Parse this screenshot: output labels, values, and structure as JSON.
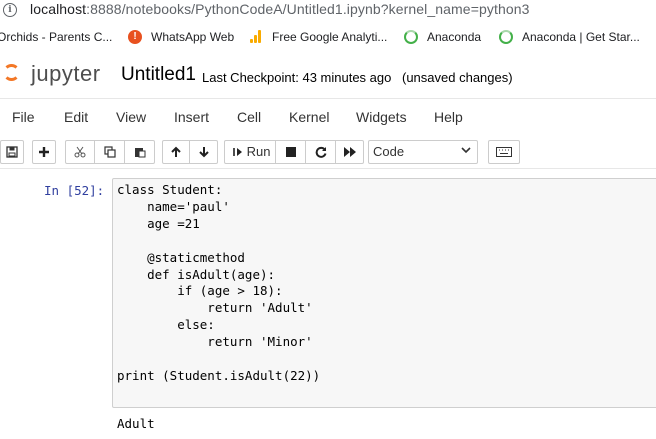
{
  "browser": {
    "url_host": "localhost",
    "url_rest": ":8888/notebooks/PythonCodeA/Untitled1.ipynb?kernel_name=python3"
  },
  "bookmarks": [
    {
      "label": "Orchids - Parents C...",
      "icon": "orchid-icon"
    },
    {
      "label": "WhatsApp Web",
      "icon": "whatsapp-icon"
    },
    {
      "label": "Free Google Analyti...",
      "icon": "analytics-icon"
    },
    {
      "label": "Anaconda",
      "icon": "anaconda-icon"
    },
    {
      "label": "Anaconda | Get Star...",
      "icon": "anaconda-icon"
    }
  ],
  "header": {
    "logo_text": "jupyter",
    "notebook_title": "Untitled1",
    "checkpoint_label": "Last Checkpoint:",
    "checkpoint_time": "43 minutes ago",
    "save_status": "(unsaved changes)"
  },
  "menu": [
    "File",
    "Edit",
    "View",
    "Insert",
    "Cell",
    "Kernel",
    "Widgets",
    "Help"
  ],
  "toolbar": {
    "run_label": "Run",
    "cell_type": "Code",
    "icons": [
      "save-icon",
      "add-cell-icon",
      "cut-icon",
      "copy-icon",
      "paste-icon",
      "move-up-icon",
      "move-down-icon",
      "run-icon",
      "interrupt-icon",
      "restart-icon",
      "fast-forward-icon",
      "keyboard-icon"
    ]
  },
  "cell": {
    "prompt": "In [52]:",
    "code": "class Student:\n    name='paul'\n    age =21\n\n    @staticmethod\n    def isAdult(age):\n        if (age > 18):\n            return 'Adult'\n        else:\n            return 'Minor'\n\nprint (Student.isAdult(22))",
    "output": "Adult"
  },
  "colors": {
    "jupyter_orange": "#f37726",
    "prompt_blue": "#303f9f",
    "code_bg": "#f7f7f7"
  }
}
